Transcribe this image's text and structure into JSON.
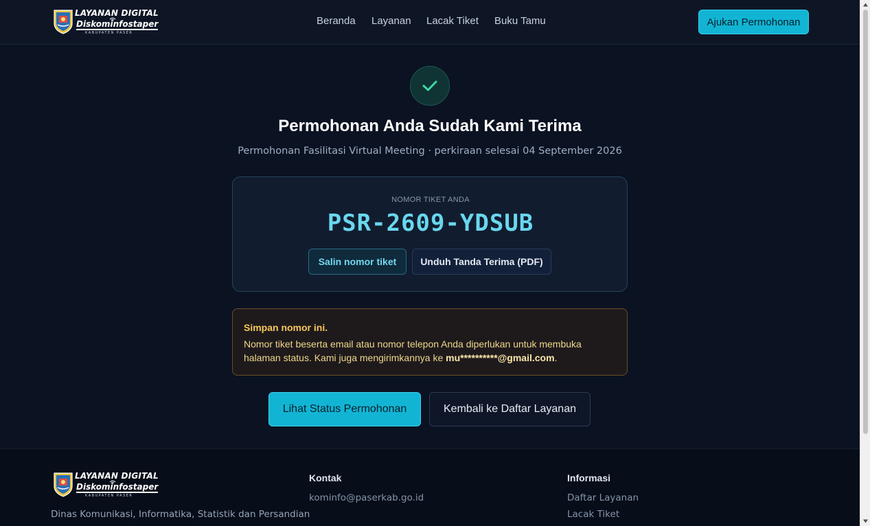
{
  "brand": {
    "title": "LAYANAN DIGITAL",
    "subtitle": "Diskominfostaper",
    "region": "KABUPATEN PASER"
  },
  "nav": {
    "items": [
      "Beranda",
      "Layanan",
      "Lacak Tiket",
      "Buku Tamu"
    ],
    "cta_label": "Ajukan Permohonan"
  },
  "main": {
    "title": "Permohonan Anda Sudah Kami Terima",
    "subtitle": "Permohonan Fasilitasi Virtual Meeting · perkiraan selesai 04 September 2026",
    "ticket": {
      "label": "NOMOR TIKET ANDA",
      "number": "PSR-2609-YDSUB",
      "copy_label": "Salin nomor tiket",
      "download_label": "Unduh Tanda Terima (PDF)"
    },
    "notice": {
      "title": "Simpan nomor ini.",
      "body": "Nomor tiket beserta email atau nomor telepon Anda diperlukan untuk membuka halaman status. Kami juga mengirimkannya ke ",
      "email": "mu**********@gmail.com",
      "end": "."
    },
    "status_button": "Lihat Status Permohonan",
    "back_button": "Kembali ke Daftar Layanan"
  },
  "footer": {
    "description": "Dinas Komunikasi, Informatika, Statistik dan Persandian",
    "contact_title": "Kontak",
    "contact_email": "kominfo@paserkab.go.id",
    "info_title": "Informasi",
    "info_links": [
      "Daftar Layanan",
      "Lacak Tiket"
    ]
  },
  "colors": {
    "accent": "#12b4d4",
    "background": "#0b1222",
    "success": "#3fd6a3",
    "warning": "#f7c85a"
  },
  "icons": {
    "success": "check-icon",
    "logo": "shield-emblem-icon"
  }
}
